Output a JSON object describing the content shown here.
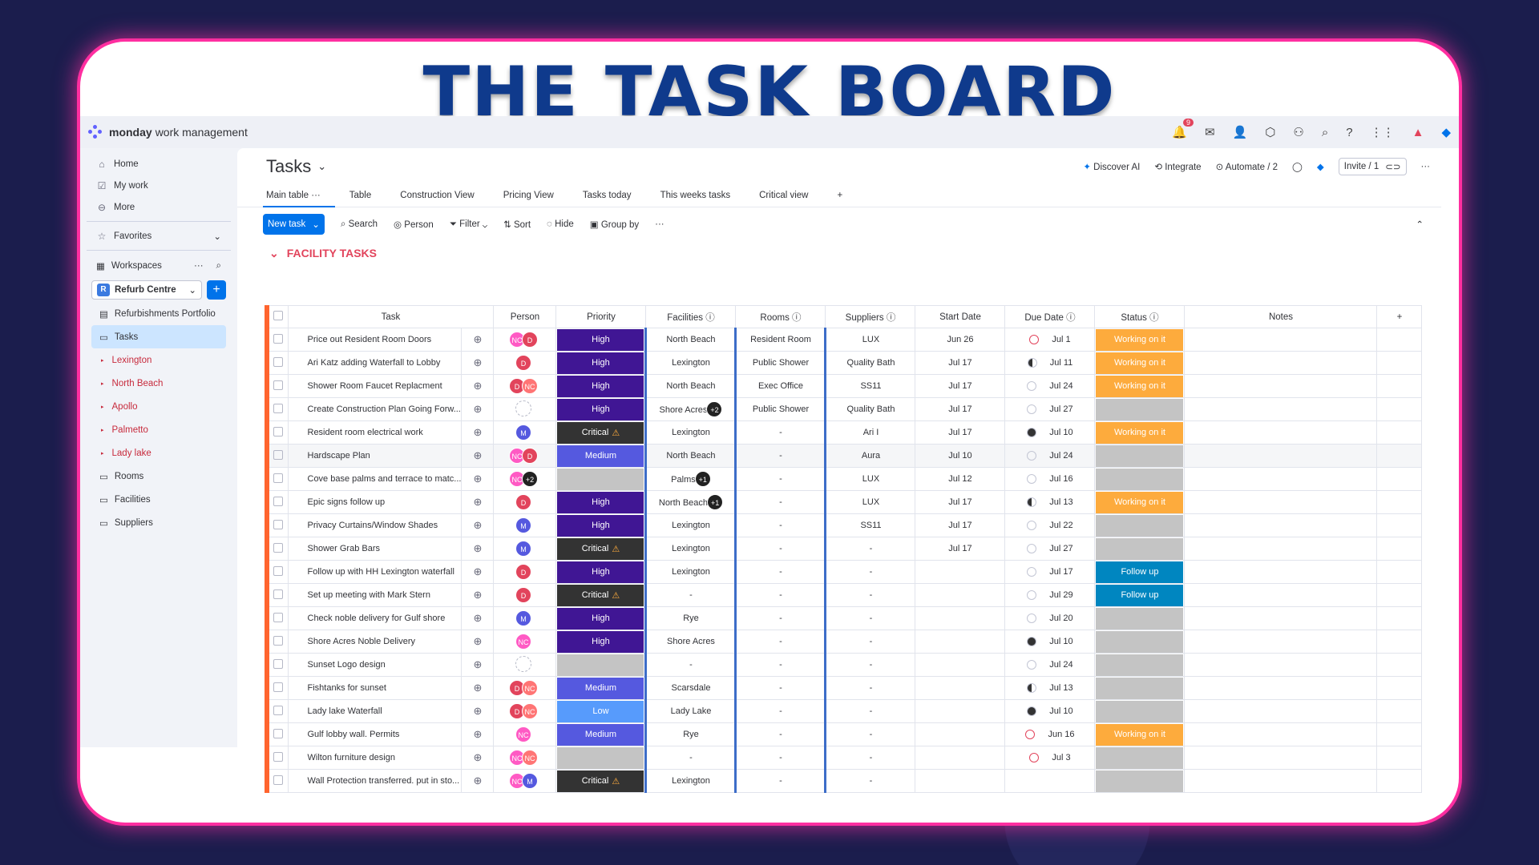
{
  "banner_title": "THE TASK BOARD",
  "app": {
    "brand_bold": "monday",
    "brand_rest": "work management",
    "notif_count": "9"
  },
  "sidebar": {
    "home": "Home",
    "mywork": "My work",
    "more": "More",
    "favorites": "Favorites",
    "workspaces": "Workspaces",
    "workspace_name": "Refurb Centre",
    "workspace_initial": "R",
    "items": [
      "Refurbishments Portfolio",
      "Tasks"
    ],
    "sub_items": [
      "Lexington",
      "North Beach",
      "Apollo",
      "Palmetto",
      "Lady lake"
    ],
    "more_items": [
      "Rooms",
      "Facilities",
      "Suppliers"
    ]
  },
  "board": {
    "title": "Tasks",
    "discover_ai": "Discover AI",
    "integrate": "Integrate",
    "automate": "Automate / 2",
    "invite": "Invite / 1",
    "tabs": [
      "Main table",
      "Table",
      "Construction View",
      "Pricing View",
      "Tasks today",
      "This weeks tasks",
      "Critical view"
    ],
    "toolbar": {
      "new_task": "New task",
      "search": "Search",
      "person": "Person",
      "filter": "Filter",
      "sort": "Sort",
      "hide": "Hide",
      "group_by": "Group by"
    },
    "group_title": "FACILITY TASKS",
    "columns": [
      "Task",
      "Person",
      "Priority",
      "Facilities",
      "Rooms",
      "Suppliers",
      "Start Date",
      "Due Date",
      "Status",
      "Notes"
    ],
    "rows": [
      {
        "task": "Price out Resident Room Doors",
        "people": [
          "NC",
          "D"
        ],
        "priority": "High",
        "facility": "North Beach",
        "room": "Resident Room",
        "supplier": "LUX",
        "start": "Jun 26",
        "due": "Jul 1",
        "due_icon": "red",
        "status": "Working on it"
      },
      {
        "task": "Ari Katz adding Waterfall to Lobby",
        "people": [
          "D"
        ],
        "priority": "High",
        "facility": "Lexington",
        "room": "Public Shower",
        "supplier": "Quality Bath",
        "start": "Jul 17",
        "due": "Jul 11",
        "due_icon": "half",
        "status": "Working on it"
      },
      {
        "task": "Shower Room Faucet Replacment",
        "people": [
          "D",
          "NC"
        ],
        "priority": "High",
        "facility": "North Beach",
        "room": "Exec Office",
        "supplier": "SS11",
        "start": "Jul 17",
        "due": "Jul 24",
        "due_icon": "empty",
        "status": "Working on it"
      },
      {
        "task": "Create Construction Plan Going Forw...",
        "people": [
          "empty"
        ],
        "priority": "High",
        "facility": "Shore Acres",
        "facility_badge": "+2",
        "room": "Public Shower",
        "supplier": "Quality Bath",
        "start": "Jul 17",
        "due": "Jul 27",
        "due_icon": "empty",
        "status": ""
      },
      {
        "task": "Resident room electrical work",
        "people": [
          "M"
        ],
        "priority": "Critical",
        "facility": "Lexington",
        "room": "-",
        "supplier": "Ari I",
        "start": "Jul 17",
        "due": "Jul 10",
        "due_icon": "full",
        "status": "Working on it"
      },
      {
        "task": "Hardscape Plan",
        "people": [
          "NC",
          "D"
        ],
        "priority": "Medium",
        "facility": "North Beach",
        "room": "-",
        "supplier": "Aura",
        "start": "Jul 10",
        "due": "Jul 24",
        "due_icon": "empty",
        "status": ""
      },
      {
        "task": "Cove base palms and terrace to matc...",
        "people": [
          "NC",
          "+2"
        ],
        "priority": "",
        "facility": "Palms",
        "facility_badge": "+1",
        "room": "-",
        "supplier": "LUX",
        "start": "Jul 12",
        "due": "Jul 16",
        "due_icon": "empty",
        "status": ""
      },
      {
        "task": "Epic signs follow up",
        "people": [
          "D"
        ],
        "priority": "High",
        "facility": "North Beach",
        "facility_badge": "+1",
        "room": "-",
        "supplier": "LUX",
        "start": "Jul 17",
        "due": "Jul 13",
        "due_icon": "half",
        "status": "Working on it"
      },
      {
        "task": "Privacy Curtains/Window Shades",
        "people": [
          "M"
        ],
        "priority": "High",
        "facility": "Lexington",
        "room": "-",
        "supplier": "SS11",
        "start": "Jul 17",
        "due": "Jul 22",
        "due_icon": "empty",
        "status": ""
      },
      {
        "task": "Shower Grab Bars",
        "people": [
          "M"
        ],
        "priority": "Critical",
        "facility": "Lexington",
        "room": "-",
        "supplier": "-",
        "start": "Jul 17",
        "due": "Jul 27",
        "due_icon": "empty",
        "status": ""
      },
      {
        "task": "Follow up with HH Lexington waterfall",
        "people": [
          "D"
        ],
        "priority": "High",
        "facility": "Lexington",
        "room": "-",
        "supplier": "-",
        "start": "",
        "due": "Jul 17",
        "due_icon": "empty",
        "status": "Follow up"
      },
      {
        "task": "Set up meeting with Mark Stern",
        "people": [
          "D"
        ],
        "priority": "Critical",
        "facility": "-",
        "room": "-",
        "supplier": "-",
        "start": "",
        "due": "Jul 29",
        "due_icon": "empty",
        "status": "Follow up"
      },
      {
        "task": "Check noble delivery for Gulf shore",
        "people": [
          "M"
        ],
        "priority": "High",
        "facility": "Rye",
        "room": "-",
        "supplier": "-",
        "start": "",
        "due": "Jul 20",
        "due_icon": "empty",
        "status": ""
      },
      {
        "task": "Shore Acres Noble Delivery",
        "people": [
          "NC"
        ],
        "priority": "High",
        "facility": "Shore Acres",
        "room": "-",
        "supplier": "-",
        "start": "",
        "due": "Jul 10",
        "due_icon": "full",
        "status": ""
      },
      {
        "task": "Sunset Logo design",
        "people": [
          "empty"
        ],
        "priority": "",
        "facility": "-",
        "room": "-",
        "supplier": "-",
        "start": "",
        "due": "Jul 24",
        "due_icon": "empty",
        "status": ""
      },
      {
        "task": "Fishtanks for sunset",
        "people": [
          "D",
          "NC"
        ],
        "priority": "Medium",
        "facility": "Scarsdale",
        "room": "-",
        "supplier": "-",
        "start": "",
        "due": "Jul 13",
        "due_icon": "half",
        "status": ""
      },
      {
        "task": "Lady lake Waterfall",
        "people": [
          "D",
          "NC"
        ],
        "priority": "Low",
        "facility": "Lady Lake",
        "room": "-",
        "supplier": "-",
        "start": "",
        "due": "Jul 10",
        "due_icon": "full",
        "status": ""
      },
      {
        "task": "Gulf lobby wall. Permits",
        "people": [
          "NC"
        ],
        "priority": "Medium",
        "facility": "Rye",
        "room": "-",
        "supplier": "-",
        "start": "",
        "due": "Jun 16",
        "due_icon": "red",
        "status": "Working on it"
      },
      {
        "task": "Wilton furniture design",
        "people": [
          "NC",
          "NC"
        ],
        "priority": "",
        "facility": "-",
        "room": "-",
        "supplier": "-",
        "start": "",
        "due": "Jul 3",
        "due_icon": "red",
        "status": ""
      },
      {
        "task": "Wall Protection transferred. put in sto...",
        "people": [
          "NC",
          "M"
        ],
        "priority": "Critical",
        "facility": "Lexington",
        "room": "-",
        "supplier": "-",
        "start": "",
        "due": "",
        "due_icon": "",
        "status": ""
      }
    ]
  }
}
